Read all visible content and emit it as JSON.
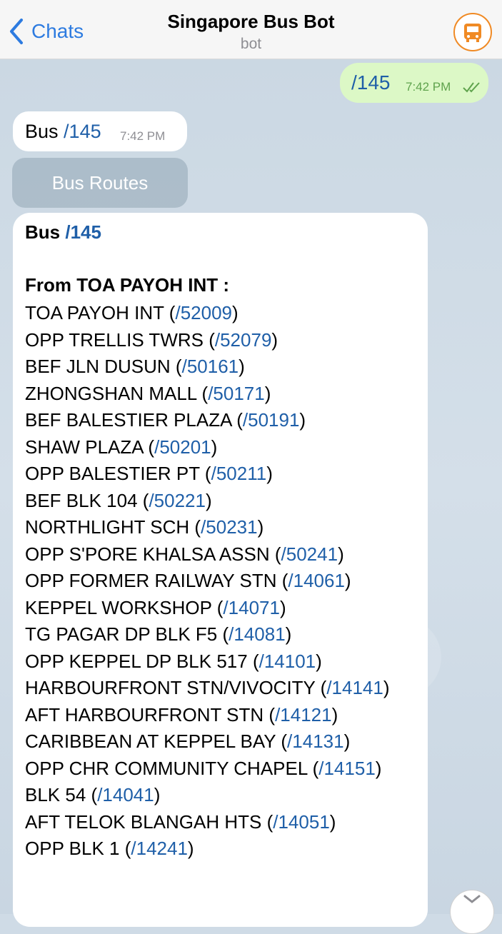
{
  "header": {
    "back_label": "Chats",
    "title": "Singapore Bus Bot",
    "subtitle": "bot",
    "brand_color": "#f08a24"
  },
  "messages": {
    "outgoing": {
      "text": "/145",
      "time": "7:42 PM",
      "status": "read"
    },
    "incoming_1": {
      "prefix": "Bus",
      "link": "/145",
      "time": "7:42 PM"
    },
    "keyboard_button": "Bus Routes",
    "route": {
      "title_prefix": "Bus",
      "title_link": "/145",
      "from_label": "From TOA PAYOH INT :",
      "stops": [
        {
          "name": "TOA PAYOH INT",
          "code": "/52009"
        },
        {
          "name": "OPP TRELLIS TWRS",
          "code": "/52079"
        },
        {
          "name": "BEF JLN DUSUN",
          "code": "/50161"
        },
        {
          "name": "ZHONGSHAN MALL",
          "code": "/50171"
        },
        {
          "name": "BEF BALESTIER PLAZA",
          "code": "/50191"
        },
        {
          "name": "SHAW PLAZA",
          "code": "/50201"
        },
        {
          "name": "OPP BALESTIER PT",
          "code": "/50211"
        },
        {
          "name": "BEF BLK 104",
          "code": "/50221"
        },
        {
          "name": "NORTHLIGHT SCH",
          "code": "/50231"
        },
        {
          "name": "OPP S'PORE KHALSA ASSN",
          "code": "/50241"
        },
        {
          "name": "OPP FORMER RAILWAY STN",
          "code": "/14061"
        },
        {
          "name": "KEPPEL WORKSHOP",
          "code": "/14071"
        },
        {
          "name": "TG PAGAR DP BLK F5",
          "code": "/14081"
        },
        {
          "name": "OPP KEPPEL DP BLK 517",
          "code": "/14101"
        },
        {
          "name": "HARBOURFRONT STN/VIVOCITY",
          "code": "/14141"
        },
        {
          "name": "AFT HARBOURFRONT STN",
          "code": "/14121"
        },
        {
          "name": "CARIBBEAN AT KEPPEL BAY",
          "code": "/14131"
        },
        {
          "name": "OPP CHR COMMUNITY CHAPEL",
          "code": "/14151"
        },
        {
          "name": "BLK 54",
          "code": "/14041"
        },
        {
          "name": "AFT TELOK BLANGAH HTS",
          "code": "/14051"
        },
        {
          "name": "OPP BLK 1",
          "code": "/14241"
        }
      ]
    }
  }
}
